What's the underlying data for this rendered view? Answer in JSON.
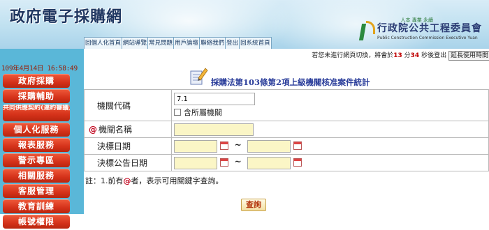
{
  "header": {
    "site_title": "政府電子採購網",
    "agency_slogan": "人本 專業 永續",
    "agency_name": "行政院公共工程委員會",
    "agency_en": "Public Construction Commission Executive Yuan",
    "tabs": [
      "回個人化首頁",
      "網站導覽",
      "常見問題",
      "用戶論壇",
      "聯絡我們",
      "登出",
      "回系統首頁"
    ]
  },
  "sidebar": {
    "datetime": "109年4月14日 16:58:49",
    "menu": [
      {
        "label": "政府採購",
        "small": false
      },
      {
        "label": "採購輔助",
        "small": false
      },
      {
        "label": "共同供應契約(違約審議)",
        "small": true
      },
      {
        "label": "個人化服務",
        "small": false
      },
      {
        "label": "報表服務",
        "small": false
      },
      {
        "label": "警示專區",
        "small": false
      },
      {
        "label": "相關服務",
        "small": false
      },
      {
        "label": "客服管理",
        "small": false
      },
      {
        "label": "教育訓練",
        "small": false
      },
      {
        "label": "帳號權限",
        "small": false
      }
    ]
  },
  "session": {
    "prefix": "若您未進行網頁切換，將會於",
    "minutes": "13",
    "min_unit": "分",
    "seconds": "34",
    "sec_unit": "秒",
    "suffix": "後登出",
    "extend_label": "延長使用時間"
  },
  "page": {
    "title": "採購法第103條第2項上級機關核准案件統計"
  },
  "form": {
    "agency_code_label": "機關代碼",
    "agency_code_value": "7.1",
    "include_sub_label": "含所屬機關",
    "required_mark": "@",
    "agency_name_label": "機關名稱",
    "agency_name_value": "",
    "award_date_label": "決標日期",
    "award_notice_date_label": "決標公告日期",
    "range_sep": "~"
  },
  "note": {
    "prefix": "註：1.前有",
    "mark": "@",
    "suffix": "者，表示可用關鍵字查詢。"
  },
  "actions": {
    "query_label": "查詢"
  },
  "colors": {
    "sidebar_bg": "#5ab7d8",
    "menu_red": "#d5321a",
    "title_blue": "#2a3d9a",
    "required_red": "#c0001a",
    "input_yellow": "#fbf6c6"
  }
}
